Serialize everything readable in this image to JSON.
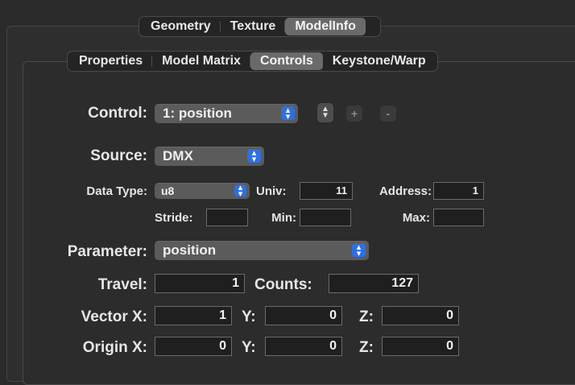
{
  "top_tabs": [
    {
      "label": "Geometry",
      "active": false
    },
    {
      "label": "Texture",
      "active": false
    },
    {
      "label": "ModelInfo",
      "active": true
    }
  ],
  "sub_tabs": [
    {
      "label": "Properties",
      "active": false
    },
    {
      "label": "Model Matrix",
      "active": false
    },
    {
      "label": "Controls",
      "active": true
    },
    {
      "label": "Keystone/Warp",
      "active": false
    }
  ],
  "control": {
    "label": "Control:",
    "value": "1: position",
    "add_label": "+",
    "remove_label": "-"
  },
  "source": {
    "label": "Source:",
    "value": "DMX"
  },
  "data_type": {
    "label": "Data Type:",
    "value": "u8",
    "univ_label": "Univ:",
    "univ_value": "11",
    "address_label": "Address:",
    "address_value": "1"
  },
  "stride": {
    "stride_label": "Stride:",
    "stride_value": "",
    "min_label": "Min:",
    "min_value": "",
    "max_label": "Max:",
    "max_value": ""
  },
  "parameter": {
    "label": "Parameter:",
    "value": "position"
  },
  "travel": {
    "label": "Travel:",
    "value": "1",
    "counts_label": "Counts:",
    "counts_value": "127"
  },
  "vector": {
    "x_label": "Vector X:",
    "x_value": "1",
    "y_label": "Y:",
    "y_value": "0",
    "z_label": "Z:",
    "z_value": "0"
  },
  "origin": {
    "x_label": "Origin X:",
    "x_value": "0",
    "y_label": "Y:",
    "y_value": "0",
    "z_label": "Z:",
    "z_value": "0"
  },
  "colors": {
    "accent": "#2f6fe0",
    "background": "#2b2b2b",
    "active_tab": "#6a6a6a"
  }
}
